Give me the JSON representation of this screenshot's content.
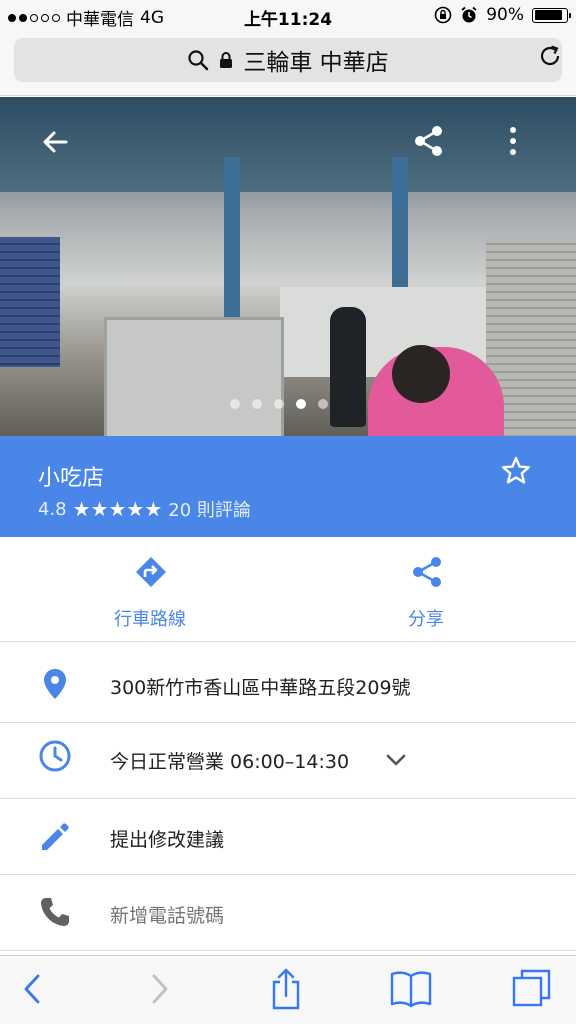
{
  "status_bar": {
    "carrier": "中華電信",
    "network": "4G",
    "time": "上午11:24",
    "battery": "90%",
    "battery_level": 0.9,
    "signal_bars_filled": 2,
    "signal_bars_total": 5
  },
  "url_bar": {
    "title": "三輪車 中華店",
    "search_icon": "search-icon",
    "lock_icon": "lock-icon",
    "reload_icon": "reload-icon"
  },
  "photo": {
    "page_count": 5,
    "active_page": 4
  },
  "place": {
    "category": "小吃店",
    "rating": "4.8",
    "stars": "★★★★★",
    "reviews": "20 則評論",
    "accent": "#4a86e8"
  },
  "actions": {
    "directions_label": "行車路線",
    "share_label": "分享"
  },
  "details": {
    "address": "300新竹市香山區中華路五段209號",
    "hours": "今日正常營業 06:00–14:30",
    "suggest_edit": "提出修改建議",
    "add_phone": "新增電話號碼"
  }
}
